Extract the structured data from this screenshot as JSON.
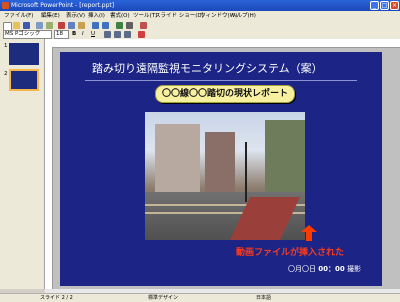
{
  "window": {
    "title": "Microsoft PowerPoint - [report.ppt]"
  },
  "menu": [
    "ファイル(F)",
    "編集(E)",
    "表示(V)",
    "挿入(I)",
    "書式(O)",
    "ツール(T)",
    "スライド ショー(D)",
    "ウィンドウ(W)",
    "ヘルプ(H)"
  ],
  "toolbar": {
    "font_name": "MS Pゴシック",
    "font_size": "18"
  },
  "thumbnails": [
    {
      "number": "1"
    },
    {
      "number": "2"
    }
  ],
  "slide": {
    "title": "踏み切り遠隔監視モニタリングシステム（案）",
    "subtitle": "〇〇線〇〇踏切の現状レポート",
    "caption": "動画ファイルが挿入された",
    "date_prefix": "〇月〇日",
    "date_time": "00：00",
    "date_suffix": "撮影"
  },
  "status": {
    "slide_info": "スライド 2 / 2",
    "design": "標準デザイン",
    "language": "日本語"
  },
  "colors": {
    "slide_bg": "#1c2585",
    "subtitle_bg": "#f7f0a0",
    "caption": "#ff3a1a"
  }
}
